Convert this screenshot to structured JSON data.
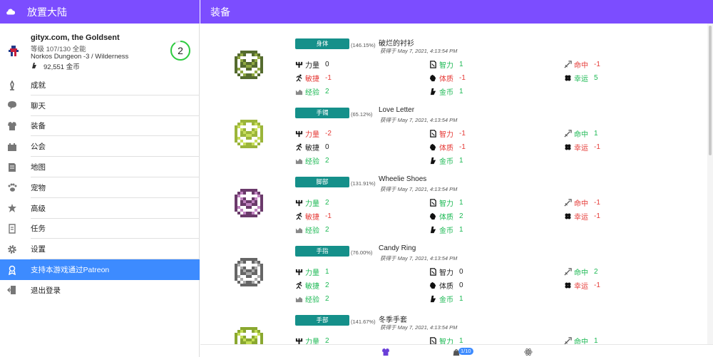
{
  "app": {
    "title": "放置大陆",
    "page_title": "装备"
  },
  "profile": {
    "name": "gityx.com, the Goldsent",
    "level": "等级 107/130 全能",
    "location": "Norkos Dungeon -3 / Wilderness",
    "gold": "92,551 金币",
    "ring_value": "2",
    "ring_progress": 0.9
  },
  "menu": [
    {
      "label": "成就",
      "icon": "achievement-icon"
    },
    {
      "label": "聊天",
      "icon": "chat-icon"
    },
    {
      "label": "装备",
      "icon": "equipment-icon"
    },
    {
      "label": "公会",
      "icon": "guild-icon"
    },
    {
      "label": "地图",
      "icon": "map-icon"
    },
    {
      "label": "宠物",
      "icon": "pet-paw-icon"
    },
    {
      "label": "高级",
      "icon": "premium-icon"
    },
    {
      "label": "任务",
      "icon": "quest-icon"
    },
    {
      "label": "设置",
      "icon": "gear-icon"
    },
    {
      "label": "支持本游戏通过Patreon",
      "icon": "patreon-icon",
      "active": true
    },
    {
      "label": "退出登录",
      "icon": "logout-icon"
    }
  ],
  "stat_labels": {
    "str": "力量",
    "int": "智力",
    "hit": "命中",
    "agi": "敏捷",
    "con": "体质",
    "luck": "幸运",
    "exp": "经验",
    "gold": "金币"
  },
  "items": [
    {
      "slot": "身体",
      "percent": "(146.15%)",
      "name": "破烂的衬衫",
      "obtained": "获得于 May 7, 2021, 4:13:54 PM",
      "stats": {
        "str": "0",
        "int": "1",
        "hit": "-1",
        "agi": "-1",
        "con": "-1",
        "luck": "5",
        "exp": "2",
        "gold": "1"
      }
    },
    {
      "slot": "手镯",
      "percent": "(65.12%)",
      "name": "Love Letter",
      "obtained": "获得于 May 7, 2021, 4:13:54 PM",
      "stats": {
        "str": "-2",
        "int": "-1",
        "hit": "1",
        "agi": "0",
        "con": "-1",
        "luck": "-1",
        "exp": "2",
        "gold": "1"
      }
    },
    {
      "slot": "脚部",
      "percent": "(131.91%)",
      "name": "Wheelie Shoes",
      "obtained": "获得于 May 7, 2021, 4:13:54 PM",
      "stats": {
        "str": "2",
        "int": "1",
        "hit": "-1",
        "agi": "-1",
        "con": "2",
        "luck": "-1",
        "exp": "2",
        "gold": "1"
      }
    },
    {
      "slot": "手指",
      "percent": "(76.00%)",
      "name": "Candy Ring",
      "obtained": "获得于 May 7, 2021, 4:13:54 PM",
      "stats": {
        "str": "1",
        "int": "0",
        "hit": "2",
        "agi": "2",
        "con": "0",
        "luck": "-1",
        "exp": "2",
        "gold": "1"
      }
    },
    {
      "slot": "手部",
      "percent": "(141.67%)",
      "name": "冬季手套",
      "obtained": "获得于 May 7, 2021, 4:13:54 PM",
      "stats": {
        "str": "2",
        "int": "1",
        "hit": "1"
      }
    }
  ],
  "bottom": {
    "badge": "1/10"
  },
  "colors": {
    "primary": "#7c4dff",
    "active": "#3d8bff",
    "badge": "#15908a",
    "positive": "#1db954",
    "negative": "#e53935"
  }
}
